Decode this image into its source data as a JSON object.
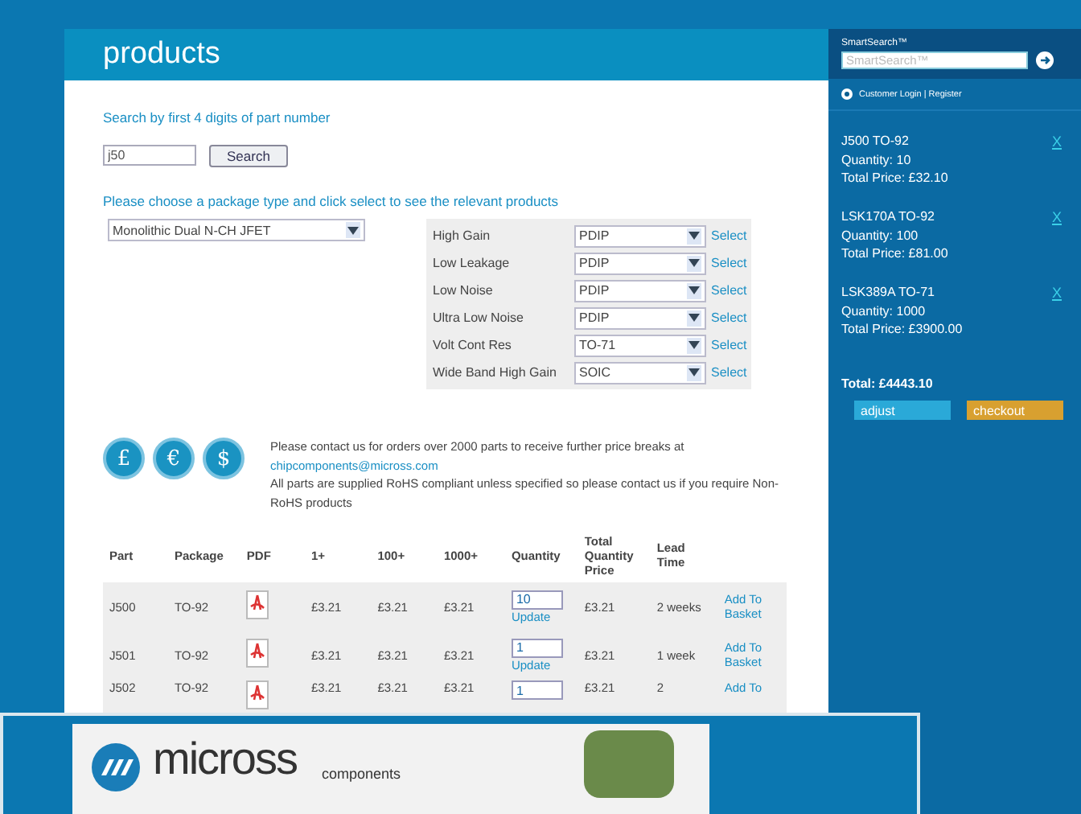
{
  "header": {
    "title": "products"
  },
  "search": {
    "label": "Search by first 4 digits of part number",
    "value": "j50",
    "button": "Search"
  },
  "package_prompt": "Please choose a package type and click select to see the relevant products",
  "family_select": {
    "value": "Monolithic Dual N-CH JFET"
  },
  "package_rows": [
    {
      "label": "High Gain",
      "value": "PDIP",
      "link": "Select"
    },
    {
      "label": "Low Leakage",
      "value": "PDIP",
      "link": "Select"
    },
    {
      "label": "Low Noise",
      "value": "PDIP",
      "link": "Select"
    },
    {
      "label": "Ultra Low Noise",
      "value": "PDIP",
      "link": "Select"
    },
    {
      "label": "Volt Cont Res",
      "value": "TO-71",
      "link": "Select"
    },
    {
      "label": "Wide Band High Gain",
      "value": "SOIC",
      "link": "Select"
    }
  ],
  "currencies": [
    "£",
    "€",
    "$"
  ],
  "notice": {
    "line1": "Please contact us for orders over 2000 parts to receive further price breaks at",
    "email": "chipcomponents@micross.com",
    "line2": "All parts are supplied RoHS compliant unless specified so please contact us if you require Non-RoHS products"
  },
  "table": {
    "columns": [
      "Part",
      "Package",
      "PDF",
      "1+",
      "100+",
      "1000+",
      "Quantity",
      "Total Quantity Price",
      "Lead Time"
    ],
    "rows": [
      {
        "part": "J500",
        "package": "TO-92",
        "p1": "£3.21",
        "p100": "£3.21",
        "p1000": "£3.21",
        "quantity": "10",
        "update": "Update",
        "total": "£3.21",
        "lead": "2 weeks",
        "basket": "Add To Basket"
      },
      {
        "part": "J501",
        "package": "TO-92",
        "p1": "£3.21",
        "p100": "£3.21",
        "p1000": "£3.21",
        "quantity": "1",
        "update": "Update",
        "total": "£3.21",
        "lead": "1 week",
        "basket": "Add To Basket"
      },
      {
        "part": "J502",
        "package": "TO-92",
        "p1": "£3.21",
        "p100": "£3.21",
        "p1000": "£3.21",
        "quantity": "1",
        "total": "£3.21",
        "lead": "2",
        "basket": "Add To"
      }
    ]
  },
  "sidebar": {
    "smartsearch_label": "SmartSearch™",
    "smartsearch_placeholder": "SmartSearch™",
    "login": "Customer Login | Register",
    "cart": [
      {
        "name": "J500 TO-92",
        "quantity": "Quantity: 10",
        "price": "Total Price: £32.10",
        "remove": "X"
      },
      {
        "name": "LSK170A TO-92",
        "quantity": "Quantity: 100",
        "price": "Total Price: £81.00",
        "remove": "X"
      },
      {
        "name": "LSK389A TO-71",
        "quantity": "Quantity: 1000",
        "price": "Total Price: £3900.00",
        "remove": "X"
      }
    ],
    "total": "Total: £4443.10",
    "buttons": [
      {
        "label": "adjust",
        "kind": "adjust"
      },
      {
        "label": "checkout",
        "kind": "checkout"
      }
    ]
  },
  "overlay_window": {
    "brand": "micross",
    "brand_sub": "components"
  }
}
